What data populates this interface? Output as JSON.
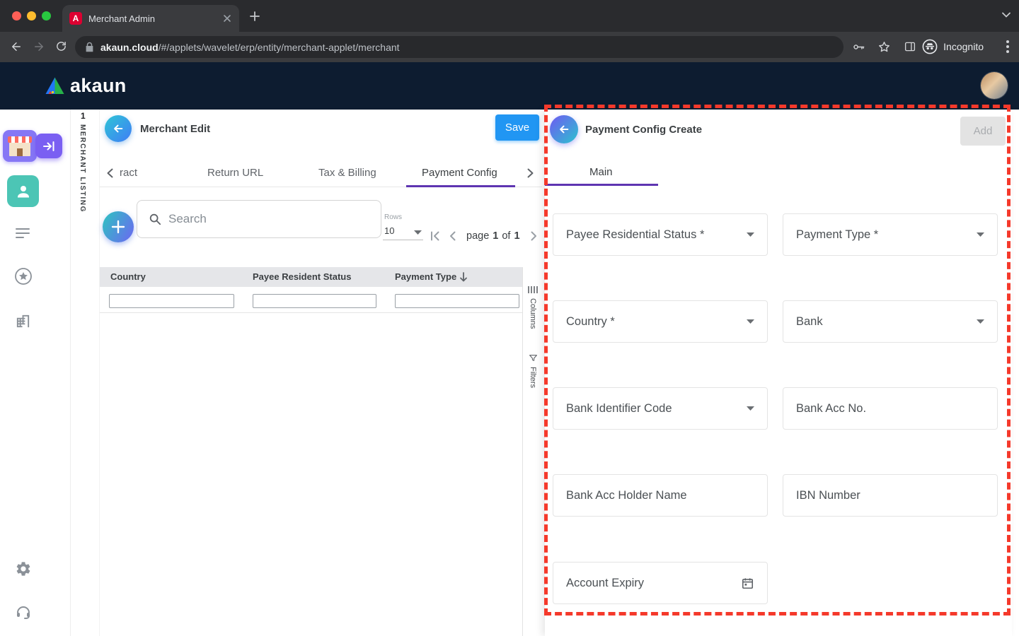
{
  "browser": {
    "tab_title": "Merchant Admin",
    "favicon_letter": "A",
    "url_domain": "akaun.cloud",
    "url_path": "/#/applets/wavelet/erp/entity/merchant-applet/merchant",
    "incognito_label": "Incognito"
  },
  "app_header": {
    "brand": "akaun"
  },
  "nav_rail": {
    "badge_number": "1",
    "vertical_label": "MERCHANT LISTING"
  },
  "left_panel": {
    "title": "Merchant Edit",
    "save_button": "Save",
    "tabs": [
      {
        "label": "ract"
      },
      {
        "label": "Return URL"
      },
      {
        "label": "Tax & Billing"
      },
      {
        "label": "Payment Config"
      }
    ],
    "active_tab": "Payment Config",
    "search_placeholder": "Search",
    "rows_label": "Rows",
    "rows_per_page": "10",
    "pagination": {
      "page_word": "page",
      "current_page": "1",
      "of_word": "of",
      "total_pages": "1"
    },
    "table_columns": [
      "Country",
      "Payee Resident Status",
      "Payment Type"
    ],
    "sorted_column": "Payment Type",
    "sort_direction": "desc",
    "rail_buttons": [
      "Columns",
      "Filters"
    ]
  },
  "right_panel": {
    "title": "Payment Config Create",
    "add_button": "Add",
    "tabs": [
      {
        "label": "Main"
      }
    ],
    "active_tab": "Main",
    "fields": [
      {
        "label": "Payee Residential Status *",
        "control": "select"
      },
      {
        "label": "Payment Type *",
        "control": "select"
      },
      {
        "label": "Country *",
        "control": "select"
      },
      {
        "label": "Bank",
        "control": "select"
      },
      {
        "label": "Bank Identifier Code",
        "control": "select"
      },
      {
        "label": "Bank Acc No.",
        "control": "text"
      },
      {
        "label": "Bank Acc Holder Name",
        "control": "text"
      },
      {
        "label": "IBN Number",
        "control": "text"
      },
      {
        "label": "Account Expiry",
        "control": "date"
      }
    ]
  },
  "colors": {
    "app_header_bg": "#0d1c30",
    "primary_blue": "#2196f3",
    "tab_indicator_purple": "#5e35b1",
    "teal_accent": "#2cc3cf",
    "annotation_red": "#f5392b",
    "disabled_button_bg": "#e3e3e3"
  },
  "icons": {
    "favicon": "angular-shield-a",
    "search": "magnifier",
    "sort": "arrow-down",
    "rows_select": "caret-down",
    "pagination": [
      "first-page",
      "prev-page",
      "next-page",
      "last-page"
    ],
    "rail": [
      "column-bars",
      "funnel"
    ],
    "account_expiry": "calendar",
    "sidebar": [
      "storefront",
      "enter-arrow",
      "person",
      "list-lines",
      "star-circle",
      "buildings",
      "gear",
      "headset"
    ],
    "browser": [
      "lock",
      "key",
      "bookmark-star",
      "side-panel",
      "incognito-spy",
      "kebab-menu"
    ]
  }
}
